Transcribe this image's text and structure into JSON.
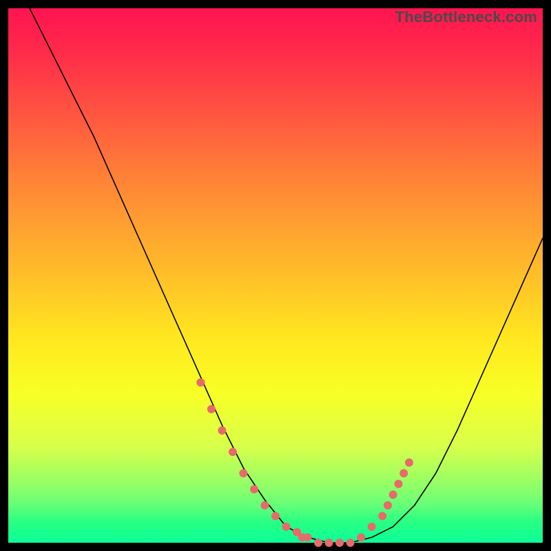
{
  "watermark": "TheBottleneck.com",
  "chart_data": {
    "type": "line",
    "title": "",
    "xlabel": "",
    "ylabel": "",
    "xlim": [
      0,
      100
    ],
    "ylim": [
      0,
      100
    ],
    "series": [
      {
        "name": "bottleneck-curve",
        "x": [
          4,
          8,
          12,
          16,
          20,
          24,
          28,
          32,
          36,
          40,
          44,
          48,
          52,
          56,
          60,
          64,
          68,
          72,
          76,
          80,
          84,
          88,
          92,
          96,
          100
        ],
        "values": [
          100,
          92,
          84,
          76,
          67,
          58,
          49,
          40,
          31,
          22,
          14,
          8,
          3,
          1,
          0,
          0,
          1,
          3,
          7,
          13,
          21,
          30,
          39,
          48,
          57
        ]
      }
    ],
    "markers": {
      "name": "highlight-points",
      "color": "#e86a6a",
      "x": [
        36,
        38,
        40,
        42,
        44,
        46,
        48,
        50,
        52,
        54,
        55,
        56,
        58,
        60,
        62,
        64,
        66,
        68,
        70,
        71,
        72,
        73,
        74,
        75
      ],
      "values": [
        30,
        25,
        21,
        17,
        13,
        10,
        7,
        5,
        3,
        2,
        1,
        1,
        0,
        0,
        0,
        0,
        1,
        3,
        5,
        7,
        9,
        11,
        13,
        15
      ]
    },
    "legend": {
      "visible": false
    },
    "grid": false
  }
}
